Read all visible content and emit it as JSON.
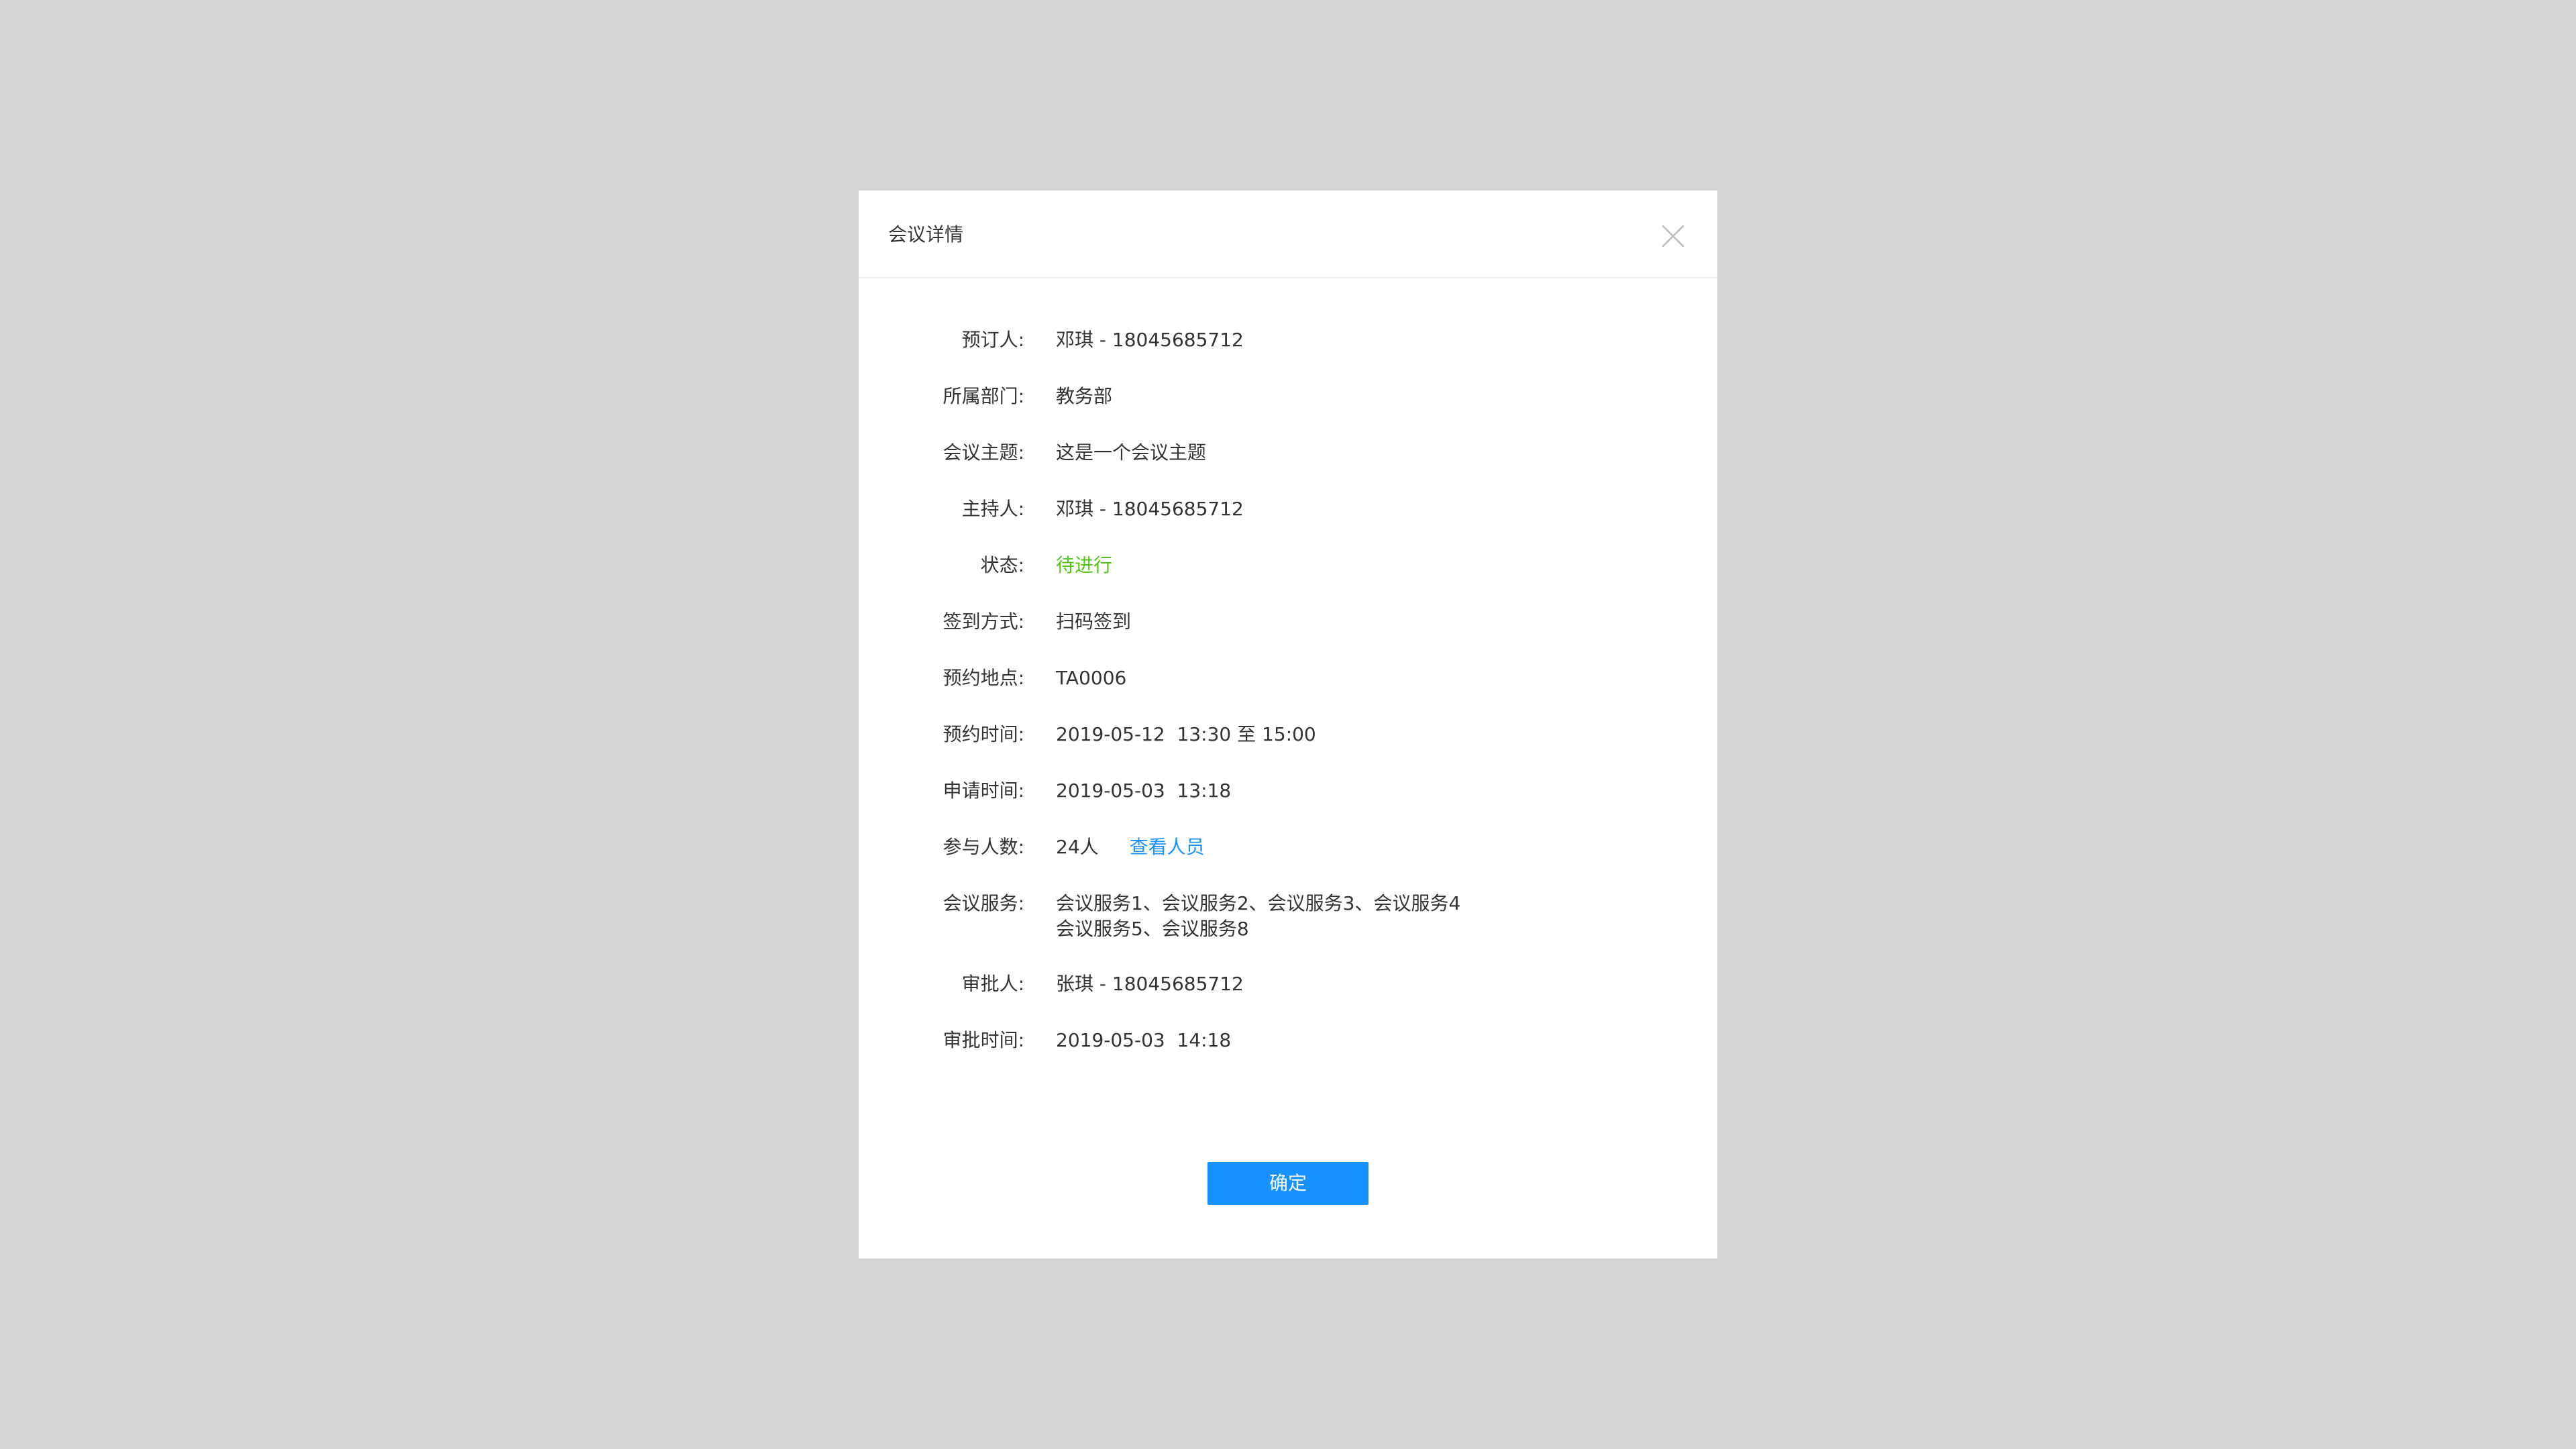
{
  "dialog": {
    "title": "会议详情",
    "close_icon": "close-icon",
    "confirm_label": "确定"
  },
  "details": {
    "booker": {
      "label": "预订人:",
      "value": "邓琪 - 18045685712"
    },
    "department": {
      "label": "所属部门:",
      "value": "教务部"
    },
    "topic": {
      "label": "会议主题:",
      "value": "这是一个会议主题"
    },
    "host": {
      "label": "主持人:",
      "value": "邓琪 - 18045685712"
    },
    "status": {
      "label": "状态:",
      "value": "待进行"
    },
    "checkin": {
      "label": "签到方式:",
      "value": "扫码签到"
    },
    "location": {
      "label": "预约地点:",
      "value": "TA0006"
    },
    "booking_time": {
      "label": "预约时间:",
      "value": "2019-05-12  13:30 至 15:00"
    },
    "apply_time": {
      "label": "申请时间:",
      "value": "2019-05-03  13:18"
    },
    "participants": {
      "label": "参与人数:",
      "value": "24人",
      "link": "查看人员"
    },
    "services": {
      "label": "会议服务:",
      "lines": [
        "会议服务1、会议服务2、会议服务3、会议服务4",
        "会议服务5、会议服务8"
      ]
    },
    "approver": {
      "label": "审批人:",
      "value": "张琪 - 18045685712"
    },
    "approve_time": {
      "label": "审批时间:",
      "value": "2019-05-03  14:18"
    }
  },
  "colors": {
    "overlay": "#d6d6d6",
    "primary": "#1890ff",
    "status": "#52c41a",
    "text": "#333333",
    "close_icon": "#bbbbbb"
  }
}
